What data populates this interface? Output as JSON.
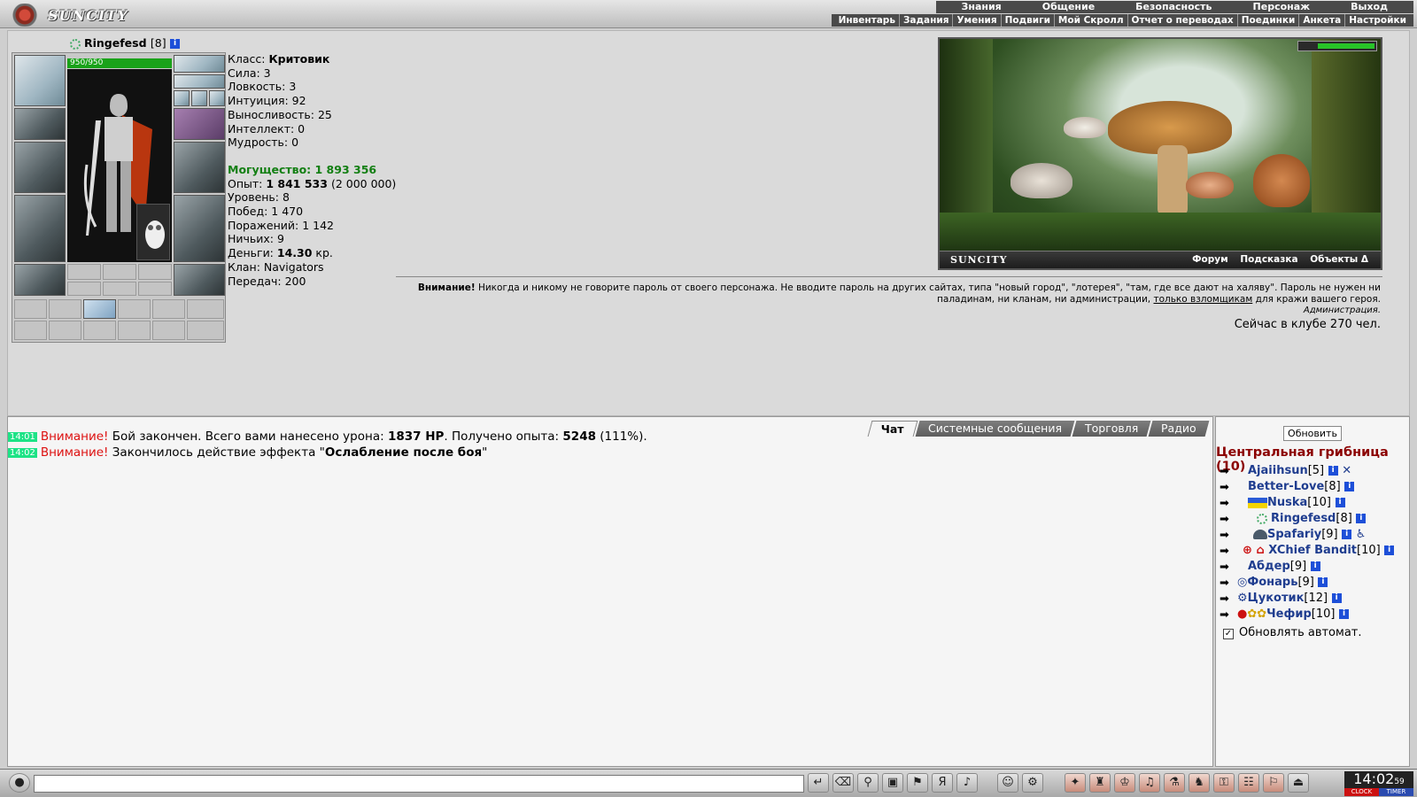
{
  "header": {
    "logo_text": "SUNCITY",
    "menu_top": [
      "Знания",
      "Общение",
      "Безопасность",
      "Персонаж",
      "Выход"
    ],
    "menu_sub": [
      "Инвентарь",
      "Задания",
      "Умения",
      "Подвиги",
      "Мой Скролл",
      "Отчет о переводах",
      "Поединки",
      "Анкета",
      "Настройки"
    ]
  },
  "character": {
    "name": "Ringefesd",
    "level": "[8]",
    "hp": "950/950",
    "stats": {
      "class_label": "Класс:",
      "class_value": "Критовик",
      "strength": "Сила: 3",
      "agility": "Ловкость: 3",
      "intuition": "Интуиция: 92",
      "endurance": "Выносливость: 25",
      "intellect": "Интеллект: 0",
      "wisdom": "Мудрость: 0",
      "power": "Могущество: 1 893 356",
      "exp_label": "Опыт:",
      "exp_value": "1 841 533",
      "exp_next": "(2 000 000)",
      "level_text": "Уровень: 8",
      "wins": "Побед: 1 470",
      "losses": "Поражений: 1 142",
      "draws": "Ничьих: 9",
      "money_label": "Деньги:",
      "money_value": "14.30",
      "money_unit": "кр.",
      "clan": "Клан: Navigators",
      "transfers": "Передач: 200"
    }
  },
  "location": {
    "brand": "SUNCITY",
    "links": [
      "Форум",
      "Подсказка",
      "Объекты Δ"
    ]
  },
  "notice": {
    "bold": "Внимание!",
    "text1": " Никогда и никому не говорите пароль от своего персонажа. Не вводите пароль на других сайтах, типа \"новый город\", \"лотерея\", \"там, где все дают на халяву\". Пароль не нужен ни паладинам, ни кланам, ни администрации, ",
    "underline": "только взломщикам",
    "text2": " для кражи вашего героя.",
    "admin": "Администрация.",
    "online": "Сейчас в клубе 270 чел."
  },
  "chat": {
    "tabs": [
      "Чат",
      "Системные сообщения",
      "Торговля",
      "Радио"
    ],
    "messages": [
      {
        "time": "14:01",
        "att": "Внимание!",
        "t1": " Бой закончен. Всего вами нанесено урона: ",
        "b1": "1837 HP",
        "t2": ". Получено опыта: ",
        "b2": "5248",
        "t3": " (111%)."
      },
      {
        "time": "14:02",
        "att": "Внимание!",
        "t1": " Закончилось действие эффекта \"",
        "b1": "Ослабление после боя",
        "t2": "\"",
        "b2": "",
        "t3": ""
      }
    ]
  },
  "userlist": {
    "refresh": "Обновить",
    "room": "Центральная грибница (10)",
    "users": [
      {
        "name": "Ajaiihsun",
        "level": "[5]"
      },
      {
        "name": "Better-Love",
        "level": "[8]"
      },
      {
        "name": "Nuska",
        "level": "[10]"
      },
      {
        "name": "Ringefesd",
        "level": "[8]"
      },
      {
        "name": "Spafariy",
        "level": "[9]"
      },
      {
        "name": "XChief Bandit",
        "level": "[10]"
      },
      {
        "name": "Абдер",
        "level": "[9]"
      },
      {
        "name": "Фонарь",
        "level": "[9]"
      },
      {
        "name": "Цукотик",
        "level": "[12]"
      },
      {
        "name": "Чефир",
        "level": "[10]"
      }
    ],
    "auto_refresh": "Обновлять автомат."
  },
  "bottom": {
    "clock": "14:02",
    "seconds": "59",
    "clock_label": "CLOCK",
    "timer_label": "TIMER"
  }
}
